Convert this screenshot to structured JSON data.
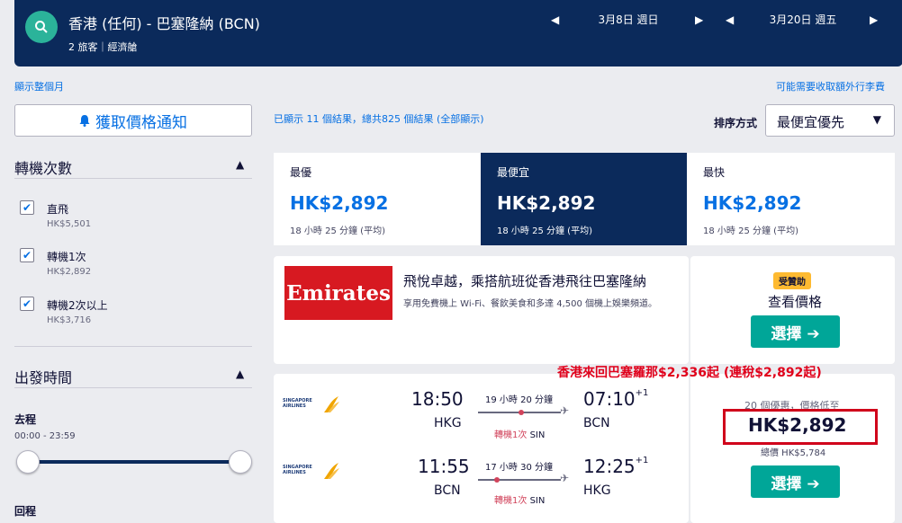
{
  "header": {
    "route": "香港 (任何) - 巴塞隆納 (BCN)",
    "pax": "2 旅客｜經濟艙",
    "depart_date": "3月8日 週日",
    "return_date": "3月20日 週五"
  },
  "links": {
    "show_month": "顯示整個月",
    "baggage": "可能需要收取額外行李費"
  },
  "sidebar": {
    "alert_btn": "獲取價格通知",
    "stops": {
      "title": "轉機次數",
      "items": [
        {
          "label": "直飛",
          "price": "HK$5,501",
          "checked": true
        },
        {
          "label": "轉機1次",
          "price": "HK$2,892",
          "checked": true
        },
        {
          "label": "轉機2次以上",
          "price": "HK$3,716",
          "checked": true
        }
      ]
    },
    "times": {
      "title": "出發時間",
      "outbound_label": "去程",
      "outbound_range": "00:00 - 23:59",
      "return_label": "回程"
    }
  },
  "results": {
    "count": "已顯示 11 個結果，總共825 個結果 (全部顯示)",
    "sort_label": "排序方式",
    "sort_value": "最便宜優先"
  },
  "tabs": [
    {
      "label": "最優",
      "price": "HK$2,892",
      "dur": "18 小時 25 分鐘 (平均)"
    },
    {
      "label": "最便宜",
      "price": "HK$2,892",
      "dur": "18 小時 25 分鐘 (平均)"
    },
    {
      "label": "最快",
      "price": "HK$2,892",
      "dur": "18 小時 25 分鐘 (平均)"
    }
  ],
  "ad": {
    "logo": "Emirates",
    "title": "飛悅卓越，乘搭航班從香港飛往巴塞隆納",
    "desc": "享用免費機上 Wi-Fi、餐飲美食和多達 4,500 個機上娛樂頻道。",
    "badge": "受贊助",
    "view_price": "查看價格",
    "select": "選擇 ➔"
  },
  "flight": {
    "airline": "SINGAPORE AIRLINES",
    "promo": "香港來回巴塞羅那$2,336起 (連稅$2,892起)",
    "deals": "20 個優惠，價格低至",
    "price": "HK$2,892",
    "total": "總價 HK$5,784",
    "select": "選擇 ➔",
    "legs": [
      {
        "dep_time": "18:50",
        "dep_code": "HKG",
        "arr_time": "07:10",
        "arr_plus": "+1",
        "arr_code": "BCN",
        "duration": "19 小時 20 分鐘",
        "stops": "轉機1次",
        "via": "SIN"
      },
      {
        "dep_time": "11:55",
        "dep_code": "BCN",
        "arr_time": "12:25",
        "arr_plus": "+1",
        "arr_code": "HKG",
        "duration": "17 小時 30 分鐘",
        "stops": "轉機1次",
        "via": "SIN"
      }
    ]
  },
  "colors": {
    "navy": "#0b2a5b",
    "teal": "#00a698",
    "link": "#0770e3",
    "stop_red": "#d1435b",
    "promo_red": "#e0001b"
  }
}
